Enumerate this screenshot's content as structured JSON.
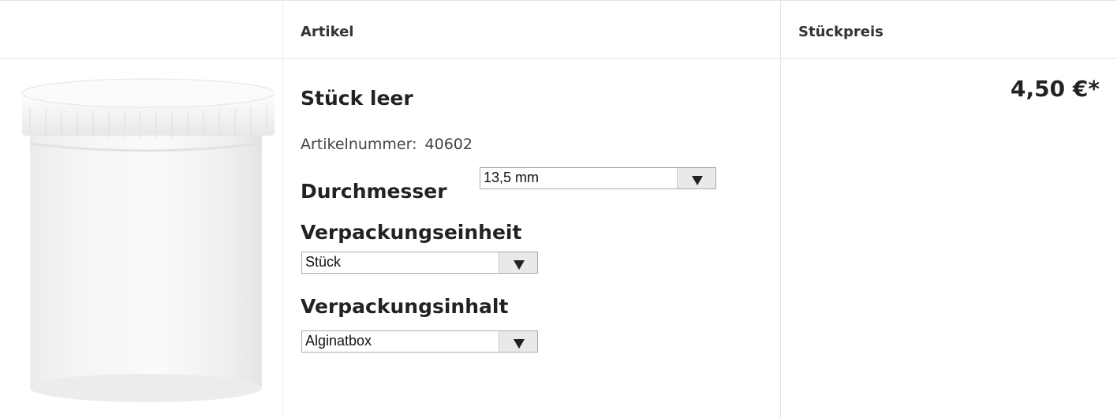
{
  "header": {
    "col_article": "Artikel",
    "col_price": "Stückpreis"
  },
  "product": {
    "image_icon": "container-jar-image",
    "title": "Stück leer",
    "article_number_label": "Artikelnummer:",
    "article_number": "40602",
    "price": "4,50 €*"
  },
  "options": {
    "diameter": {
      "label": "Durchmesser",
      "value": "13,5 mm"
    },
    "packaging_unit": {
      "label": "Verpackungseinheit",
      "value": "Stück"
    },
    "packaging_content": {
      "label": "Verpackungsinhalt",
      "value": "Alginatbox"
    }
  }
}
